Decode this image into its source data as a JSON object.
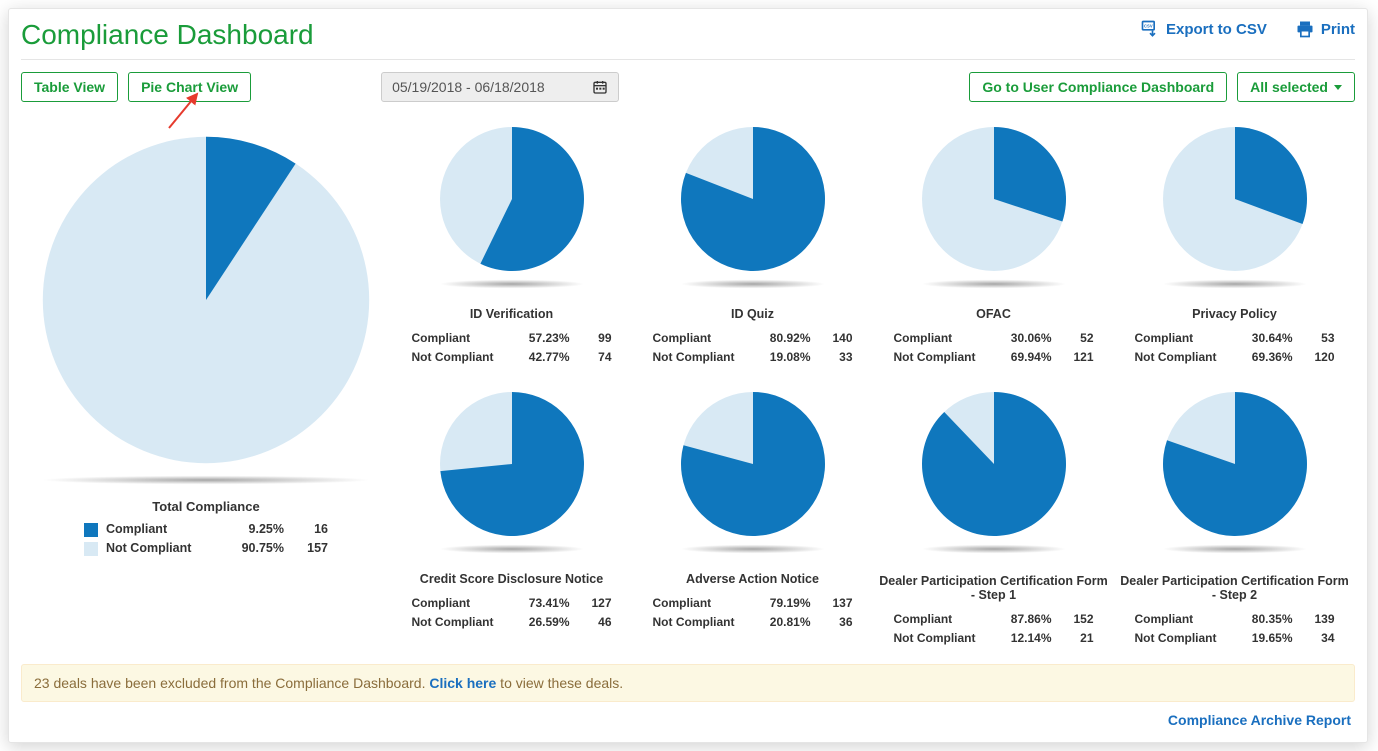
{
  "colors": {
    "compliant": "#0f77bd",
    "not_compliant": "#d8e9f4"
  },
  "header": {
    "title": "Compliance Dashboard",
    "export_csv": "Export to CSV",
    "print": "Print"
  },
  "toolbar": {
    "table_view": "Table View",
    "pie_chart_view": "Pie Chart View",
    "date_range": "05/19/2018 - 06/18/2018",
    "goto_user": "Go to User Compliance Dashboard",
    "filter": "All selected"
  },
  "labels": {
    "compliant": "Compliant",
    "not_compliant": "Not Compliant"
  },
  "total": {
    "title": "Total Compliance",
    "compliant_pct": "9.25%",
    "compliant_cnt": "16",
    "not_pct": "90.75%",
    "not_cnt": "157",
    "pct_value": 9.25
  },
  "charts": [
    {
      "title": "ID Verification",
      "compliant_pct": "57.23%",
      "compliant_cnt": "99",
      "not_pct": "42.77%",
      "not_cnt": "74",
      "pct_value": 57.23
    },
    {
      "title": "ID Quiz",
      "compliant_pct": "80.92%",
      "compliant_cnt": "140",
      "not_pct": "19.08%",
      "not_cnt": "33",
      "pct_value": 80.92
    },
    {
      "title": "OFAC",
      "compliant_pct": "30.06%",
      "compliant_cnt": "52",
      "not_pct": "69.94%",
      "not_cnt": "121",
      "pct_value": 30.06
    },
    {
      "title": "Privacy Policy",
      "compliant_pct": "30.64%",
      "compliant_cnt": "53",
      "not_pct": "69.36%",
      "not_cnt": "120",
      "pct_value": 30.64
    },
    {
      "title": "Credit Score Disclosure Notice",
      "compliant_pct": "73.41%",
      "compliant_cnt": "127",
      "not_pct": "26.59%",
      "not_cnt": "46",
      "pct_value": 73.41
    },
    {
      "title": "Adverse Action Notice",
      "compliant_pct": "79.19%",
      "compliant_cnt": "137",
      "not_pct": "20.81%",
      "not_cnt": "36",
      "pct_value": 79.19
    },
    {
      "title": "Dealer Participation Certification Form - Step 1",
      "compliant_pct": "87.86%",
      "compliant_cnt": "152",
      "not_pct": "12.14%",
      "not_cnt": "21",
      "pct_value": 87.86,
      "two_line": true
    },
    {
      "title": "Dealer Participation Certification Form -  Step 2",
      "compliant_pct": "80.35%",
      "compliant_cnt": "139",
      "not_pct": "19.65%",
      "not_cnt": "34",
      "pct_value": 80.35,
      "two_line": true
    }
  ],
  "alert": {
    "pre": "23 deals have been excluded from the Compliance Dashboard. ",
    "link": "Click here",
    "post": " to view these deals."
  },
  "footer_link": "Compliance Archive Report",
  "chart_data": [
    {
      "type": "pie",
      "title": "Total Compliance",
      "series": [
        {
          "name": "Compliant",
          "value": 16
        },
        {
          "name": "Not Compliant",
          "value": 157
        }
      ]
    },
    {
      "type": "pie",
      "title": "ID Verification",
      "series": [
        {
          "name": "Compliant",
          "value": 99
        },
        {
          "name": "Not Compliant",
          "value": 74
        }
      ]
    },
    {
      "type": "pie",
      "title": "ID Quiz",
      "series": [
        {
          "name": "Compliant",
          "value": 140
        },
        {
          "name": "Not Compliant",
          "value": 33
        }
      ]
    },
    {
      "type": "pie",
      "title": "OFAC",
      "series": [
        {
          "name": "Compliant",
          "value": 52
        },
        {
          "name": "Not Compliant",
          "value": 121
        }
      ]
    },
    {
      "type": "pie",
      "title": "Privacy Policy",
      "series": [
        {
          "name": "Compliant",
          "value": 53
        },
        {
          "name": "Not Compliant",
          "value": 120
        }
      ]
    },
    {
      "type": "pie",
      "title": "Credit Score Disclosure Notice",
      "series": [
        {
          "name": "Compliant",
          "value": 127
        },
        {
          "name": "Not Compliant",
          "value": 46
        }
      ]
    },
    {
      "type": "pie",
      "title": "Adverse Action Notice",
      "series": [
        {
          "name": "Compliant",
          "value": 137
        },
        {
          "name": "Not Compliant",
          "value": 36
        }
      ]
    },
    {
      "type": "pie",
      "title": "Dealer Participation Certification Form - Step 1",
      "series": [
        {
          "name": "Compliant",
          "value": 152
        },
        {
          "name": "Not Compliant",
          "value": 21
        }
      ]
    },
    {
      "type": "pie",
      "title": "Dealer Participation Certification Form -  Step 2",
      "series": [
        {
          "name": "Compliant",
          "value": 139
        },
        {
          "name": "Not Compliant",
          "value": 34
        }
      ]
    }
  ]
}
